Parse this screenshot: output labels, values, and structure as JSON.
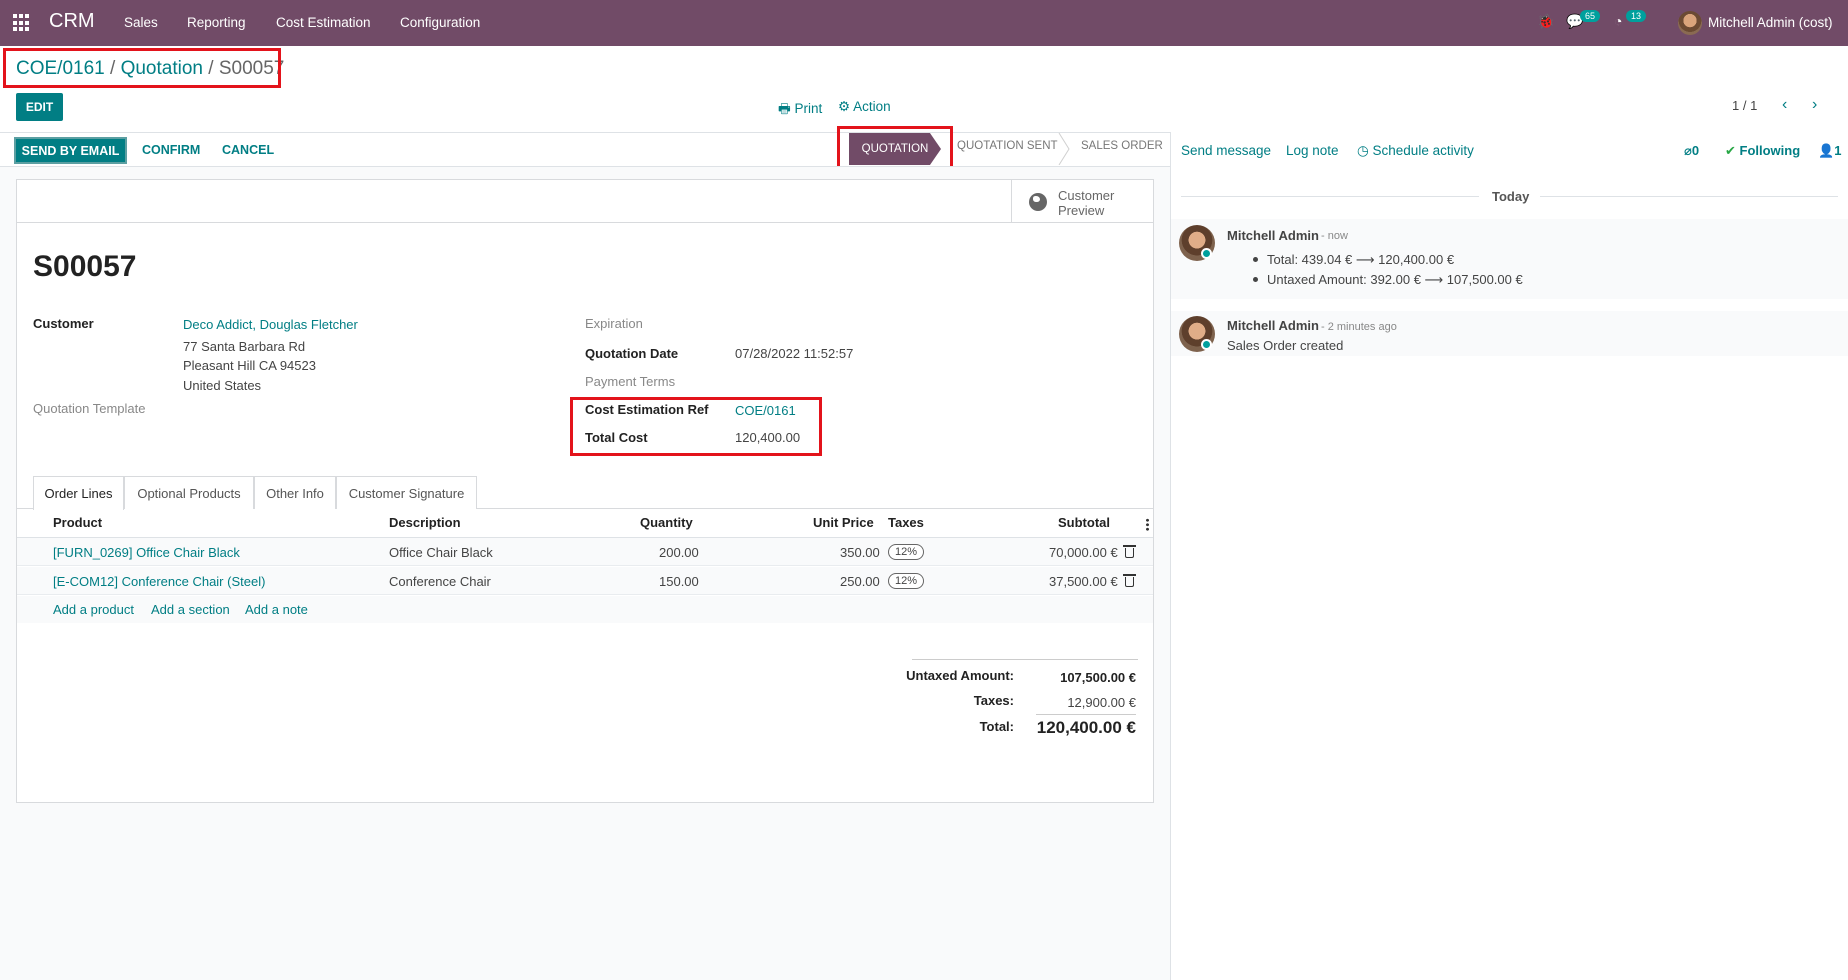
{
  "navbar": {
    "brand": "CRM",
    "menu": [
      "Sales",
      "Reporting",
      "Cost Estimation",
      "Configuration"
    ],
    "messages_count": "65",
    "activities_count": "13",
    "user": "Mitchell Admin (cost)"
  },
  "breadcrumb": {
    "items": [
      "COE/0161",
      "Quotation"
    ],
    "separator": "/",
    "current": "S00057"
  },
  "control": {
    "edit": "EDIT",
    "print": "Print",
    "action": "Action",
    "pager": "1 / 1"
  },
  "statusbar": {
    "send_email": "SEND BY EMAIL",
    "confirm": "CONFIRM",
    "cancel": "CANCEL",
    "stages": [
      "QUOTATION",
      "QUOTATION SENT",
      "SALES ORDER"
    ]
  },
  "sheet": {
    "customer_preview": [
      "Customer",
      "Preview"
    ],
    "title": "S00057",
    "customer_label": "Customer",
    "customer_name": "Deco Addict, Douglas Fletcher",
    "address": [
      "77 Santa Barbara Rd",
      "Pleasant Hill CA 94523",
      "United States"
    ],
    "quotation_template_label": "Quotation Template",
    "expiration_label": "Expiration",
    "quotation_date_label": "Quotation Date",
    "quotation_date": "07/28/2022 11:52:57",
    "payment_terms_label": "Payment Terms",
    "cost_ref_label": "Cost Estimation Ref",
    "cost_ref": "COE/0161",
    "total_cost_label": "Total Cost",
    "total_cost": "120,400.00"
  },
  "tabs": [
    "Order Lines",
    "Optional Products",
    "Other Info",
    "Customer Signature"
  ],
  "order_lines": {
    "headers": [
      "Product",
      "Description",
      "Quantity",
      "Unit Price",
      "Taxes",
      "Subtotal"
    ],
    "rows": [
      {
        "product": "[FURN_0269] Office Chair Black",
        "description": "Office Chair Black",
        "quantity": "200.00",
        "unit_price": "350.00",
        "taxes": "12%",
        "subtotal": "70,000.00 €"
      },
      {
        "product": "[E-COM12] Conference Chair (Steel)",
        "description": "Conference Chair",
        "quantity": "150.00",
        "unit_price": "250.00",
        "taxes": "12%",
        "subtotal": "37,500.00 €"
      }
    ],
    "add_product": "Add a product",
    "add_section": "Add a section",
    "add_note": "Add a note"
  },
  "totals": {
    "untaxed_label": "Untaxed Amount:",
    "untaxed": "107,500.00 €",
    "taxes_label": "Taxes:",
    "taxes": "12,900.00 €",
    "total_label": "Total:",
    "total": "120,400.00 €"
  },
  "chatter": {
    "send_message": "Send message",
    "log_note": "Log note",
    "schedule_activity": "Schedule activity",
    "attachments": "0",
    "following": "Following",
    "followers": "1",
    "today": "Today",
    "messages": [
      {
        "author": "Mitchell Admin",
        "when": "- now",
        "lines": [
          "Total: 439.04 € ⟶ 120,400.00 €",
          "Untaxed Amount: 392.00 € ⟶ 107,500.00 €"
        ]
      },
      {
        "author": "Mitchell Admin",
        "when": "- 2 minutes ago",
        "text": "Sales Order created"
      }
    ]
  },
  "colors": {
    "brand": "#714b67",
    "accent": "#017e84",
    "highlight": "#e3131b",
    "online": "#00a09d"
  }
}
